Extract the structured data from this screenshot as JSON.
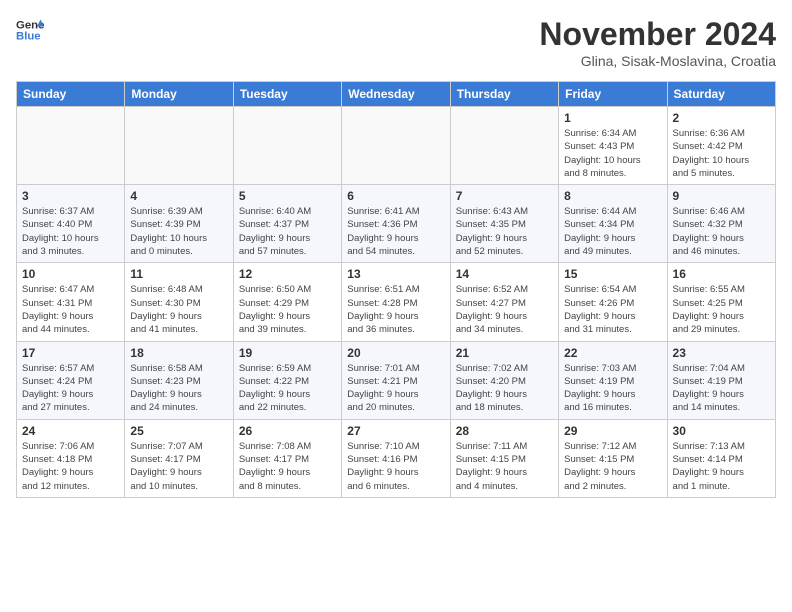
{
  "header": {
    "logo_line1": "General",
    "logo_line2": "Blue",
    "month_title": "November 2024",
    "subtitle": "Glina, Sisak-Moslavina, Croatia"
  },
  "weekdays": [
    "Sunday",
    "Monday",
    "Tuesday",
    "Wednesday",
    "Thursday",
    "Friday",
    "Saturday"
  ],
  "weeks": [
    [
      {
        "day": "",
        "info": ""
      },
      {
        "day": "",
        "info": ""
      },
      {
        "day": "",
        "info": ""
      },
      {
        "day": "",
        "info": ""
      },
      {
        "day": "",
        "info": ""
      },
      {
        "day": "1",
        "info": "Sunrise: 6:34 AM\nSunset: 4:43 PM\nDaylight: 10 hours\nand 8 minutes."
      },
      {
        "day": "2",
        "info": "Sunrise: 6:36 AM\nSunset: 4:42 PM\nDaylight: 10 hours\nand 5 minutes."
      }
    ],
    [
      {
        "day": "3",
        "info": "Sunrise: 6:37 AM\nSunset: 4:40 PM\nDaylight: 10 hours\nand 3 minutes."
      },
      {
        "day": "4",
        "info": "Sunrise: 6:39 AM\nSunset: 4:39 PM\nDaylight: 10 hours\nand 0 minutes."
      },
      {
        "day": "5",
        "info": "Sunrise: 6:40 AM\nSunset: 4:37 PM\nDaylight: 9 hours\nand 57 minutes."
      },
      {
        "day": "6",
        "info": "Sunrise: 6:41 AM\nSunset: 4:36 PM\nDaylight: 9 hours\nand 54 minutes."
      },
      {
        "day": "7",
        "info": "Sunrise: 6:43 AM\nSunset: 4:35 PM\nDaylight: 9 hours\nand 52 minutes."
      },
      {
        "day": "8",
        "info": "Sunrise: 6:44 AM\nSunset: 4:34 PM\nDaylight: 9 hours\nand 49 minutes."
      },
      {
        "day": "9",
        "info": "Sunrise: 6:46 AM\nSunset: 4:32 PM\nDaylight: 9 hours\nand 46 minutes."
      }
    ],
    [
      {
        "day": "10",
        "info": "Sunrise: 6:47 AM\nSunset: 4:31 PM\nDaylight: 9 hours\nand 44 minutes."
      },
      {
        "day": "11",
        "info": "Sunrise: 6:48 AM\nSunset: 4:30 PM\nDaylight: 9 hours\nand 41 minutes."
      },
      {
        "day": "12",
        "info": "Sunrise: 6:50 AM\nSunset: 4:29 PM\nDaylight: 9 hours\nand 39 minutes."
      },
      {
        "day": "13",
        "info": "Sunrise: 6:51 AM\nSunset: 4:28 PM\nDaylight: 9 hours\nand 36 minutes."
      },
      {
        "day": "14",
        "info": "Sunrise: 6:52 AM\nSunset: 4:27 PM\nDaylight: 9 hours\nand 34 minutes."
      },
      {
        "day": "15",
        "info": "Sunrise: 6:54 AM\nSunset: 4:26 PM\nDaylight: 9 hours\nand 31 minutes."
      },
      {
        "day": "16",
        "info": "Sunrise: 6:55 AM\nSunset: 4:25 PM\nDaylight: 9 hours\nand 29 minutes."
      }
    ],
    [
      {
        "day": "17",
        "info": "Sunrise: 6:57 AM\nSunset: 4:24 PM\nDaylight: 9 hours\nand 27 minutes."
      },
      {
        "day": "18",
        "info": "Sunrise: 6:58 AM\nSunset: 4:23 PM\nDaylight: 9 hours\nand 24 minutes."
      },
      {
        "day": "19",
        "info": "Sunrise: 6:59 AM\nSunset: 4:22 PM\nDaylight: 9 hours\nand 22 minutes."
      },
      {
        "day": "20",
        "info": "Sunrise: 7:01 AM\nSunset: 4:21 PM\nDaylight: 9 hours\nand 20 minutes."
      },
      {
        "day": "21",
        "info": "Sunrise: 7:02 AM\nSunset: 4:20 PM\nDaylight: 9 hours\nand 18 minutes."
      },
      {
        "day": "22",
        "info": "Sunrise: 7:03 AM\nSunset: 4:19 PM\nDaylight: 9 hours\nand 16 minutes."
      },
      {
        "day": "23",
        "info": "Sunrise: 7:04 AM\nSunset: 4:19 PM\nDaylight: 9 hours\nand 14 minutes."
      }
    ],
    [
      {
        "day": "24",
        "info": "Sunrise: 7:06 AM\nSunset: 4:18 PM\nDaylight: 9 hours\nand 12 minutes."
      },
      {
        "day": "25",
        "info": "Sunrise: 7:07 AM\nSunset: 4:17 PM\nDaylight: 9 hours\nand 10 minutes."
      },
      {
        "day": "26",
        "info": "Sunrise: 7:08 AM\nSunset: 4:17 PM\nDaylight: 9 hours\nand 8 minutes."
      },
      {
        "day": "27",
        "info": "Sunrise: 7:10 AM\nSunset: 4:16 PM\nDaylight: 9 hours\nand 6 minutes."
      },
      {
        "day": "28",
        "info": "Sunrise: 7:11 AM\nSunset: 4:15 PM\nDaylight: 9 hours\nand 4 minutes."
      },
      {
        "day": "29",
        "info": "Sunrise: 7:12 AM\nSunset: 4:15 PM\nDaylight: 9 hours\nand 2 minutes."
      },
      {
        "day": "30",
        "info": "Sunrise: 7:13 AM\nSunset: 4:14 PM\nDaylight: 9 hours\nand 1 minute."
      }
    ]
  ]
}
